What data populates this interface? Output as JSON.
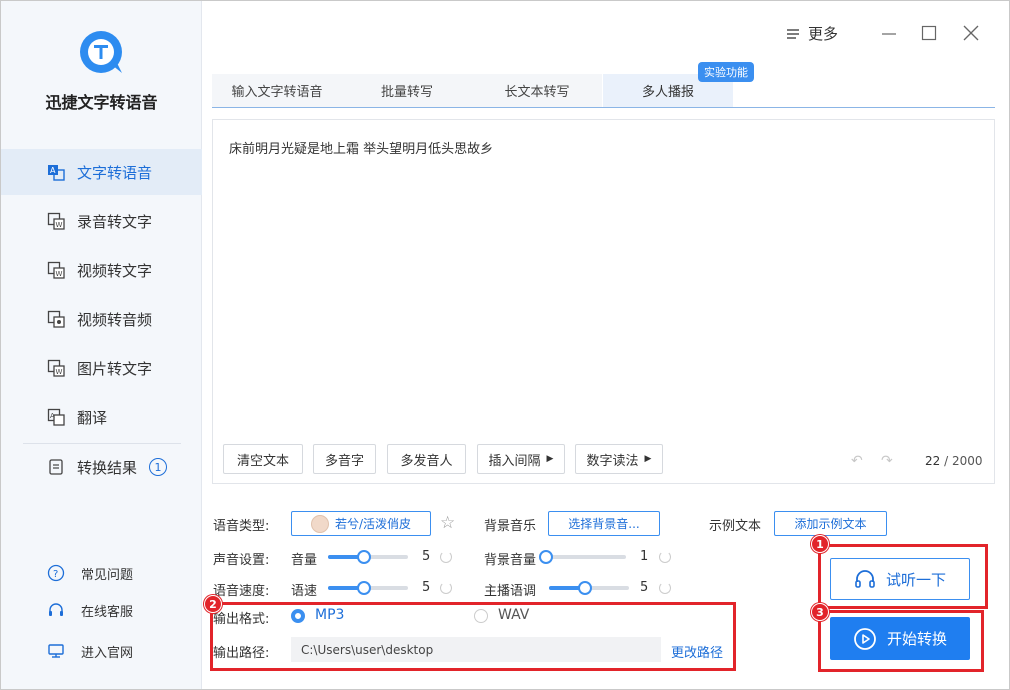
{
  "sidebar": {
    "app_name": "迅捷文字转语音",
    "items": [
      {
        "label": "文字转语音",
        "icon": "text-to-speech-icon",
        "active": true
      },
      {
        "label": "录音转文字",
        "icon": "recording-icon"
      },
      {
        "label": "视频转文字",
        "icon": "video-text-icon"
      },
      {
        "label": "视频转音频",
        "icon": "video-audio-icon"
      },
      {
        "label": "图片转文字",
        "icon": "image-text-icon"
      },
      {
        "label": "翻译",
        "icon": "translate-icon"
      },
      {
        "label": "转换结果",
        "icon": "results-icon",
        "badge": "1"
      }
    ],
    "footer": [
      {
        "label": "常见问题",
        "icon": "help-icon"
      },
      {
        "label": "在线客服",
        "icon": "headset-icon"
      },
      {
        "label": "进入官网",
        "icon": "monitor-icon"
      }
    ]
  },
  "titlebar": {
    "more_label": "更多"
  },
  "tabs": [
    {
      "label": "输入文字转语音"
    },
    {
      "label": "批量转写"
    },
    {
      "label": "长文本转写"
    },
    {
      "label": "多人播报",
      "active": true
    }
  ],
  "experimental_badge": "实验功能",
  "editor": {
    "text": "床前明月光疑是地上霜 举头望明月低头思故乡",
    "tools": [
      "清空文本",
      "多音字",
      "多发音人",
      "插入间隔",
      "数字读法"
    ],
    "char_count": "22",
    "char_max": "/ 2000"
  },
  "settings": {
    "voice_type_label": "语音类型:",
    "voice_name": "若兮/活泼俏皮",
    "bg_music_label": "背景音乐",
    "bg_music_button": "选择背景音...",
    "sample_text_label": "示例文本",
    "sample_text_button": "添加示例文本",
    "sound_label": "声音设置:",
    "volume_label": "音量",
    "volume_value": "5",
    "bg_volume_label": "背景音量",
    "bg_volume_value": "1",
    "speed_label": "语音速度:",
    "rate_label": "语速",
    "rate_value": "5",
    "pitch_label": "主播语调",
    "pitch_value": "5",
    "slider_levels": {
      "volume": 0.45,
      "bg_volume": 0.0,
      "rate": 0.45,
      "pitch": 0.45
    },
    "format_label": "输出格式:",
    "format_options": [
      "MP3",
      "WAV"
    ],
    "format_selected": "MP3",
    "path_label": "输出路径:",
    "path_value": "C:\\Users\\user\\desktop",
    "change_path": "更改路径"
  },
  "actions": {
    "listen_label": "试听一下",
    "start_label": "开始转换"
  },
  "annotations": [
    "1",
    "2",
    "3"
  ],
  "colors": {
    "accent": "#1f7ef0",
    "annotation": "#e2242a"
  }
}
